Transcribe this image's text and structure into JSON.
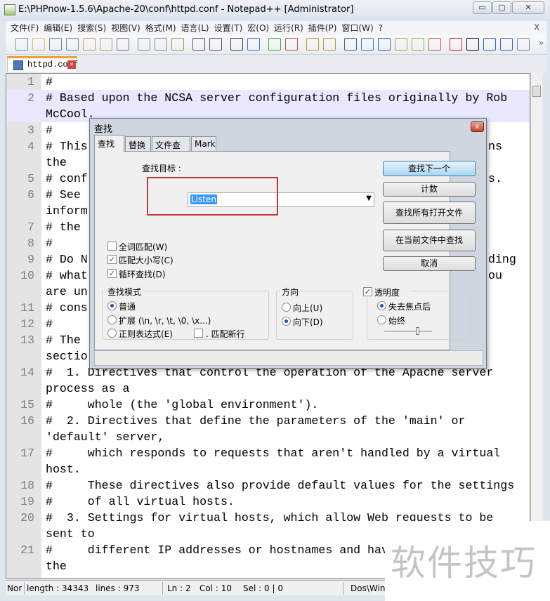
{
  "window": {
    "title": "E:\\PHPnow-1.5.6\\Apache-20\\conf\\httpd.conf - Notepad++ [Administrator]",
    "minimize": "▭",
    "maximize": "▢",
    "close": "✕"
  },
  "menu": [
    "文件(F)",
    "编辑(E)",
    "搜索(S)",
    "视图(V)",
    "格式(M)",
    "语言(L)",
    "设置(T)",
    "宏(O)",
    "运行(R)",
    "插件(P)",
    "窗口(W)",
    "?"
  ],
  "menu_close": "X",
  "toolbar": {
    "icons": [
      "new-file",
      "open-file",
      "save",
      "save-all",
      "close",
      "close-all",
      "print",
      "cut",
      "copy",
      "paste",
      "undo",
      "redo",
      "find",
      "replace",
      "zoom-in",
      "zoom-out",
      "sync-vertical",
      "sync-horizontal",
      "word-wrap",
      "show-all-chars",
      "indent-guide",
      "folder-as-workspace",
      "doc-map",
      "function-list",
      "record-macro",
      "stop-record",
      "play-macro",
      "run-macro-multiple",
      "save-macro"
    ],
    "overflow": "»"
  },
  "tab": {
    "label": "httpd.conf",
    "close": "✕"
  },
  "editor": {
    "rows": [
      {
        "n": "1",
        "t": "#"
      },
      {
        "n": "2",
        "t": "# Based upon the NCSA server configuration files originally by Rob",
        "hl": true
      },
      {
        "n": "",
        "t": "McCool.",
        "hl": true
      },
      {
        "n": "3",
        "t": "#"
      },
      {
        "n": "4",
        "t": "# This",
        "r": "ns"
      },
      {
        "n": "",
        "t": "the"
      },
      {
        "n": "5",
        "t": "# conf",
        "r": "s."
      },
      {
        "n": "6",
        "t": "# See"
      },
      {
        "n": "",
        "t": "inform"
      },
      {
        "n": "7",
        "t": "# the"
      },
      {
        "n": "8",
        "t": "#"
      },
      {
        "n": "9",
        "t": "# Do N",
        "r": "ding"
      },
      {
        "n": "10",
        "t": "# what",
        "r": "ou"
      },
      {
        "n": "",
        "t": "are un"
      },
      {
        "n": "11",
        "t": "# cons"
      },
      {
        "n": "12",
        "t": "#"
      },
      {
        "n": "13",
        "t": "# The"
      },
      {
        "n": "",
        "t": "sectio"
      },
      {
        "n": "14",
        "t": "#  1. Directives that control the operation of the Apache server"
      },
      {
        "n": "",
        "t": "process as a"
      },
      {
        "n": "15",
        "t": "#     whole (the 'global environment')."
      },
      {
        "n": "16",
        "t": "#  2. Directives that define the parameters of the 'main' or"
      },
      {
        "n": "",
        "t": "'default' server,"
      },
      {
        "n": "17",
        "t": "#     which responds to requests that aren't handled by a virtual"
      },
      {
        "n": "",
        "t": "host."
      },
      {
        "n": "18",
        "t": "#     These directives also provide default values for the settings"
      },
      {
        "n": "19",
        "t": "#     of all virtual hosts."
      },
      {
        "n": "20",
        "t": "#  3. Settings for virtual hosts, which allow Web requests to be"
      },
      {
        "n": "",
        "t": "sent to"
      },
      {
        "n": "21",
        "t": "#     different IP addresses or hostnames and hav"
      },
      {
        "n": "",
        "t": "the"
      }
    ]
  },
  "status": {
    "type": "Nor",
    "length": "length : 34343",
    "lines": "lines : 973",
    "ln": "Ln : 2",
    "col": "Col : 10",
    "sel": "Sel : 0 | 0",
    "eol": "Dos\\Win"
  },
  "watermark": "软件技巧",
  "dialog": {
    "title": "查找",
    "close": "x",
    "tabs": [
      "查找",
      "替换",
      "文件查找",
      "Mark"
    ],
    "find_label": "查找目标 :",
    "find_value": "Listen",
    "buttons": [
      "查找下一个",
      "计数",
      "查找所有打开文件",
      "在当前文件中查找",
      "取消"
    ],
    "options": [
      {
        "label": "全词匹配(W)",
        "checked": false
      },
      {
        "label": "匹配大小写(C)",
        "checked": true
      },
      {
        "label": "循环查找(D)",
        "checked": true
      }
    ],
    "mode": {
      "title": "查找模式",
      "items": [
        {
          "label": "普通",
          "on": true
        },
        {
          "label": "扩展 (\\n, \\r, \\t, \\0, \\x...)",
          "on": false
        },
        {
          "label": "正则表达式(E)",
          "on": false
        }
      ],
      "newline": ". 匹配新行"
    },
    "direction": {
      "title": "方向",
      "items": [
        {
          "label": "向上(U)",
          "on": false
        },
        {
          "label": "向下(D)",
          "on": true
        }
      ]
    },
    "transparency": {
      "title": "透明度",
      "checked": true,
      "items": [
        {
          "label": "失去焦点后",
          "on": true
        },
        {
          "label": "始终",
          "on": false
        }
      ],
      "level": 0.7
    }
  }
}
